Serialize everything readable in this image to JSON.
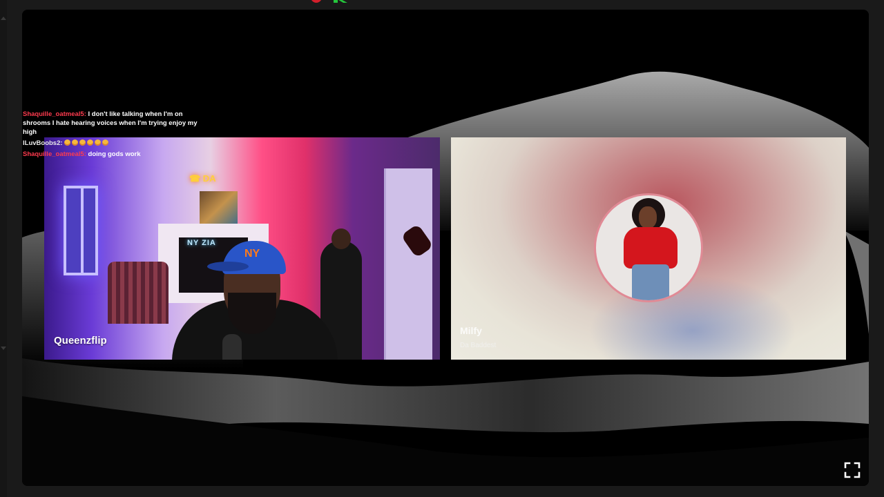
{
  "chat": {
    "messages": [
      {
        "user": "Shaquille_oatmeal5:",
        "text": "I don't like talking when I'm on shrooms I hate hearing voices when I'm trying enjoy my high"
      },
      {
        "user": "ILuvBoobs2:",
        "emote_name": "smiling-face-emote",
        "emote_count": 6
      },
      {
        "user": "Shaquille_oatmeal5:",
        "text": "doing gods work"
      }
    ]
  },
  "tiles": {
    "left": {
      "name": "Queenzflip",
      "neon_sign": "☎ DA",
      "fireplace_sign": "NY ZIA",
      "cap_logo": "NY"
    },
    "right": {
      "name": "Milfy",
      "subtitle": "Da Baddest"
    }
  },
  "controls": {
    "fullscreen_icon": "fullscreen-icon"
  },
  "colors": {
    "chat_user": "#ff3b4e",
    "avatar_ring": "#e08a95",
    "background": "#000000"
  }
}
